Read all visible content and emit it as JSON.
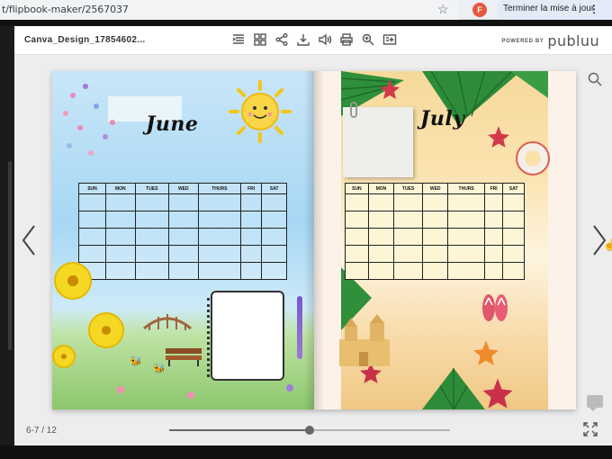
{
  "browser": {
    "url": "t/flipbook-maker/2567037",
    "profile_initial": "F",
    "update_label": "Terminer la mise à jour"
  },
  "viewer": {
    "doc_title": "Canva_Design_17854602...",
    "brand_small": "POWERED BY",
    "brand_name": "publuu",
    "page_indicator": "6-7 / 12",
    "progress_fraction": 0.5
  },
  "calendar_days": [
    "SUN",
    "MON",
    "TUES",
    "WED",
    "THURS",
    "FRI",
    "SAT"
  ],
  "pages": {
    "left_month": "June",
    "right_month": "July"
  }
}
